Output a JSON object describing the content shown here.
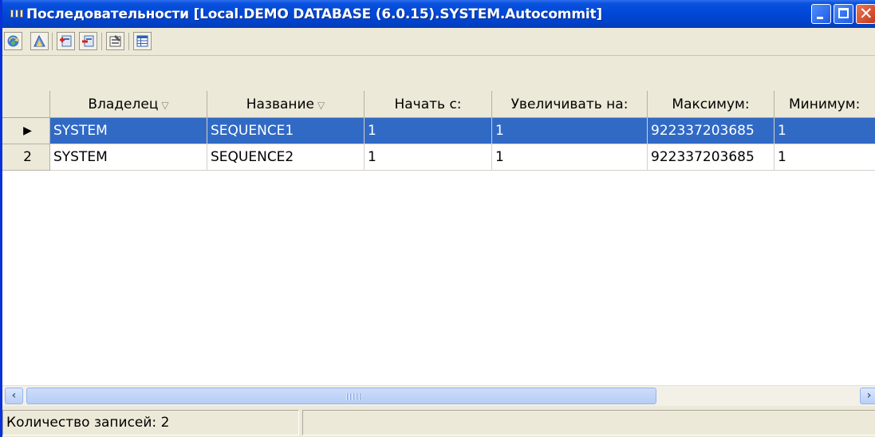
{
  "window": {
    "title": "Последовательности [Local.DEMO DATABASE (6.0.15).SYSTEM.Autocommit]"
  },
  "title_buttons": {
    "minimize": "minimize-icon",
    "maximize": "maximize-icon",
    "close": "close-icon"
  },
  "toolbar": {
    "buttons": [
      "refresh-icon",
      "sequence-icon",
      "add-icon",
      "delete-icon",
      "properties-icon",
      "grid-view-icon"
    ]
  },
  "grid": {
    "columns": [
      {
        "label": "Владелец",
        "sort": "▽"
      },
      {
        "label": "Название",
        "sort": "▽"
      },
      {
        "label": "Начать с:"
      },
      {
        "label": "Увеличивать на:"
      },
      {
        "label": "Максимум:"
      },
      {
        "label": "Минимум:"
      }
    ],
    "rows": [
      {
        "indicator": "▶",
        "selected": true,
        "cells": [
          "SYSTEM",
          "SEQUENCE1",
          "1",
          "1",
          "922337203685",
          "1"
        ]
      },
      {
        "indicator": "2",
        "selected": false,
        "cells": [
          "SYSTEM",
          "SEQUENCE2",
          "1",
          "1",
          "922337203685",
          "1"
        ]
      }
    ]
  },
  "scrollbar": {
    "left_arrow": "‹",
    "right_arrow": "›"
  },
  "status": {
    "records": "Количество записей: 2",
    "panel2": ""
  },
  "colors": {
    "selection": "#316ac5",
    "titlebar": "#0048d8"
  }
}
